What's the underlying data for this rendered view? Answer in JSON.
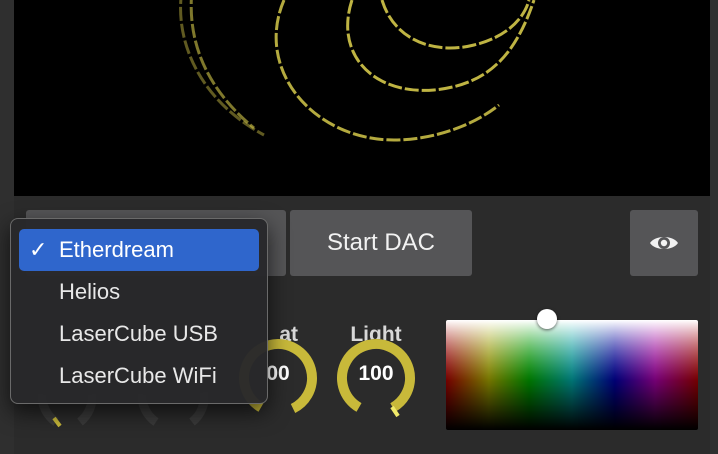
{
  "controls": {
    "start_dac_label": "Start DAC",
    "eye_icon": "eye-icon"
  },
  "dac_menu": {
    "selected_index": 0,
    "items": [
      {
        "label": "Etherdream"
      },
      {
        "label": "Helios"
      },
      {
        "label": "LaserCube USB"
      },
      {
        "label": "LaserCube WiFi"
      }
    ]
  },
  "knobs": {
    "sat": {
      "label": "at",
      "value": "00"
    },
    "light": {
      "label": "Light",
      "value": "100",
      "level": 1.0
    }
  },
  "colors": {
    "accent": "#c8b93a",
    "knob_track": "#3a3a3a",
    "button": "#555557",
    "menu_highlight": "#2f66cc",
    "laser": "#d4c84a"
  }
}
